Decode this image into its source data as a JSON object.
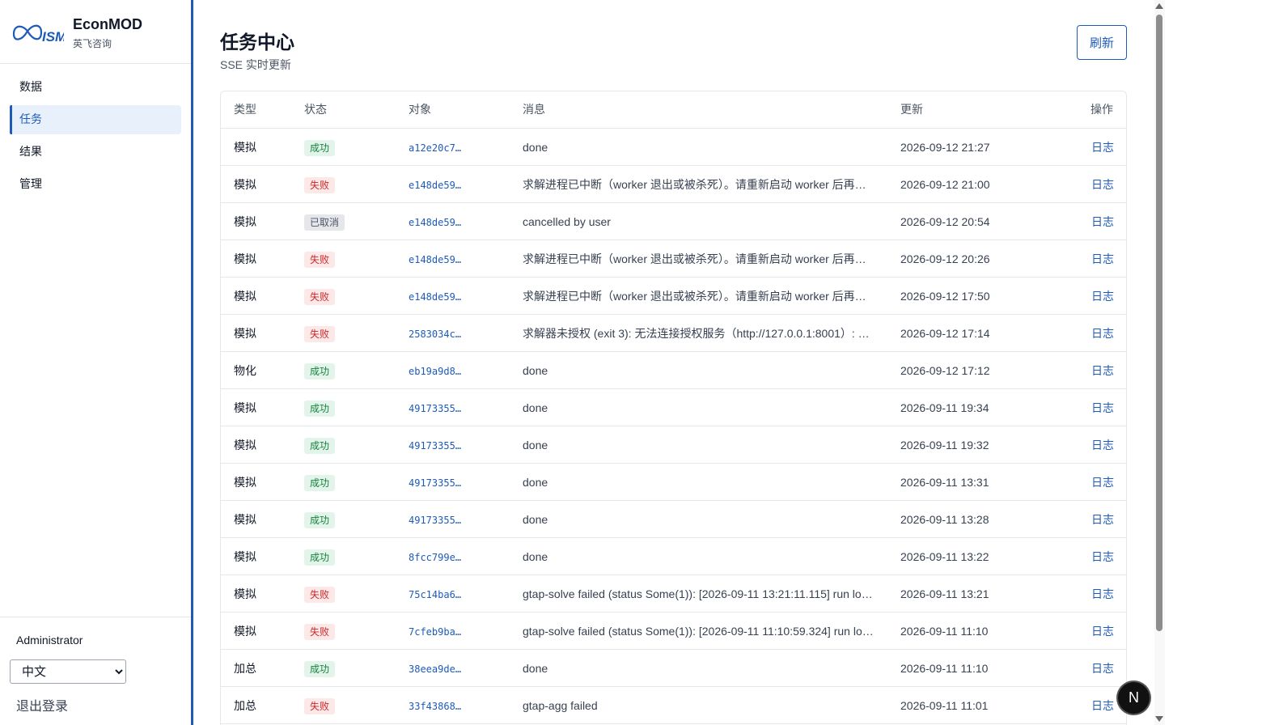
{
  "brand": {
    "name": "EconMOD",
    "subtitle": "英飞咨询",
    "logo_text": "ISM"
  },
  "nav": {
    "items": [
      {
        "label": "数据",
        "active": false
      },
      {
        "label": "任务",
        "active": true
      },
      {
        "label": "结果",
        "active": false
      },
      {
        "label": "管理",
        "active": false
      }
    ]
  },
  "user": {
    "name": "Administrator",
    "language": "中文",
    "logout_label": "退出登录"
  },
  "page": {
    "title": "任务中心",
    "subtitle": "SSE 实时更新",
    "refresh_label": "刷新"
  },
  "table": {
    "headers": {
      "type": "类型",
      "status": "状态",
      "target": "对象",
      "message": "消息",
      "updated": "更新",
      "action": "操作"
    },
    "rows": [
      {
        "type": "模拟",
        "status": "成功",
        "status_kind": "success",
        "target": "a12e20c7…",
        "message": "done",
        "updated": "2026-09-12 21:27",
        "action": "日志"
      },
      {
        "type": "模拟",
        "status": "失败",
        "status_kind": "failed",
        "target": "e148de59…",
        "message": "求解进程已中断（worker 退出或被杀死）。请重新启动 worker 后再…",
        "updated": "2026-09-12 21:00",
        "action": "日志"
      },
      {
        "type": "模拟",
        "status": "已取消",
        "status_kind": "cancelled",
        "target": "e148de59…",
        "message": "cancelled by user",
        "updated": "2026-09-12 20:54",
        "action": "日志"
      },
      {
        "type": "模拟",
        "status": "失败",
        "status_kind": "failed",
        "target": "e148de59…",
        "message": "求解进程已中断（worker 退出或被杀死）。请重新启动 worker 后再…",
        "updated": "2026-09-12 20:26",
        "action": "日志"
      },
      {
        "type": "模拟",
        "status": "失败",
        "status_kind": "failed",
        "target": "e148de59…",
        "message": "求解进程已中断（worker 退出或被杀死）。请重新启动 worker 后再…",
        "updated": "2026-09-12 17:50",
        "action": "日志"
      },
      {
        "type": "模拟",
        "status": "失败",
        "status_kind": "failed",
        "target": "2583034c…",
        "message": "求解器未授权 (exit 3): 无法连接授权服务（http://127.0.0.1:8001）: …",
        "updated": "2026-09-12 17:14",
        "action": "日志"
      },
      {
        "type": "物化",
        "status": "成功",
        "status_kind": "success",
        "target": "eb19a9d8…",
        "message": "done",
        "updated": "2026-09-12 17:12",
        "action": "日志"
      },
      {
        "type": "模拟",
        "status": "成功",
        "status_kind": "success",
        "target": "49173355…",
        "message": "done",
        "updated": "2026-09-11 19:34",
        "action": "日志"
      },
      {
        "type": "模拟",
        "status": "成功",
        "status_kind": "success",
        "target": "49173355…",
        "message": "done",
        "updated": "2026-09-11 19:32",
        "action": "日志"
      },
      {
        "type": "模拟",
        "status": "成功",
        "status_kind": "success",
        "target": "49173355…",
        "message": "done",
        "updated": "2026-09-11 13:31",
        "action": "日志"
      },
      {
        "type": "模拟",
        "status": "成功",
        "status_kind": "success",
        "target": "49173355…",
        "message": "done",
        "updated": "2026-09-11 13:28",
        "action": "日志"
      },
      {
        "type": "模拟",
        "status": "成功",
        "status_kind": "success",
        "target": "8fcc799e…",
        "message": "done",
        "updated": "2026-09-11 13:22",
        "action": "日志"
      },
      {
        "type": "模拟",
        "status": "失败",
        "status_kind": "failed",
        "target": "75c14ba6…",
        "message": "gtap-solve failed (status Some(1)): [2026-09-11 13:21:11.115] run lo…",
        "updated": "2026-09-11 13:21",
        "action": "日志"
      },
      {
        "type": "模拟",
        "status": "失败",
        "status_kind": "failed",
        "target": "7cfeb9ba…",
        "message": "gtap-solve failed (status Some(1)): [2026-09-11 11:10:59.324] run lo…",
        "updated": "2026-09-11 11:10",
        "action": "日志"
      },
      {
        "type": "加总",
        "status": "成功",
        "status_kind": "success",
        "target": "38eea9de…",
        "message": "done",
        "updated": "2026-09-11 11:10",
        "action": "日志"
      },
      {
        "type": "加总",
        "status": "失败",
        "status_kind": "failed",
        "target": "33f43868…",
        "message": "gtap-agg failed",
        "updated": "2026-09-11 11:01",
        "action": "日志"
      }
    ]
  },
  "floating_badge": {
    "label": "N"
  },
  "colors": {
    "accent": "#1e5bb8",
    "success_bg": "#e3f5ea",
    "success_fg": "#17803d",
    "failed_bg": "#fde8e8",
    "failed_fg": "#c42b2b",
    "cancelled_bg": "#e5e7eb"
  }
}
